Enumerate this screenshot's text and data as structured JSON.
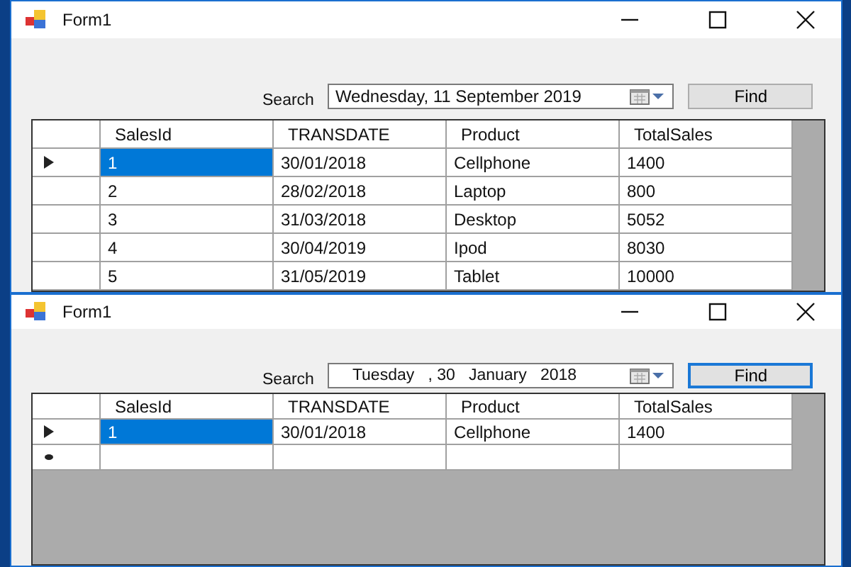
{
  "windows": [
    {
      "title": "Form1",
      "search_label": "Search",
      "date_value": "Wednesday, 11 September 2019",
      "find_button": {
        "label": "Find",
        "focused": false
      },
      "grid": {
        "columns": [
          "SalesId",
          "TRANSDATE",
          "Product",
          "TotalSales"
        ],
        "rows": [
          {
            "kind": "data",
            "selected": true,
            "cells": [
              "1",
              "30/01/2018",
              "Cellphone",
              "1400"
            ]
          },
          {
            "kind": "data",
            "selected": false,
            "cells": [
              "2",
              "28/02/2018",
              "Laptop",
              "800"
            ]
          },
          {
            "kind": "data",
            "selected": false,
            "cells": [
              "3",
              "31/03/2018",
              "Desktop",
              "5052"
            ]
          },
          {
            "kind": "data",
            "selected": false,
            "cells": [
              "4",
              "30/04/2019",
              "Ipod",
              "8030"
            ]
          },
          {
            "kind": "data",
            "selected": false,
            "cells": [
              "5",
              "31/05/2019",
              "Tablet",
              "10000"
            ]
          }
        ]
      }
    },
    {
      "title": "Form1",
      "search_label": "Search",
      "date_value": "Tuesday   , 30   January   2018",
      "find_button": {
        "label": "Find",
        "focused": true
      },
      "grid": {
        "columns": [
          "SalesId",
          "TRANSDATE",
          "Product",
          "TotalSales"
        ],
        "rows": [
          {
            "kind": "data",
            "selected": true,
            "cells": [
              "1",
              "30/01/2018",
              "Cellphone",
              "1400"
            ]
          },
          {
            "kind": "new",
            "selected": false,
            "cells": [
              "",
              "",
              "",
              ""
            ]
          }
        ]
      }
    }
  ]
}
